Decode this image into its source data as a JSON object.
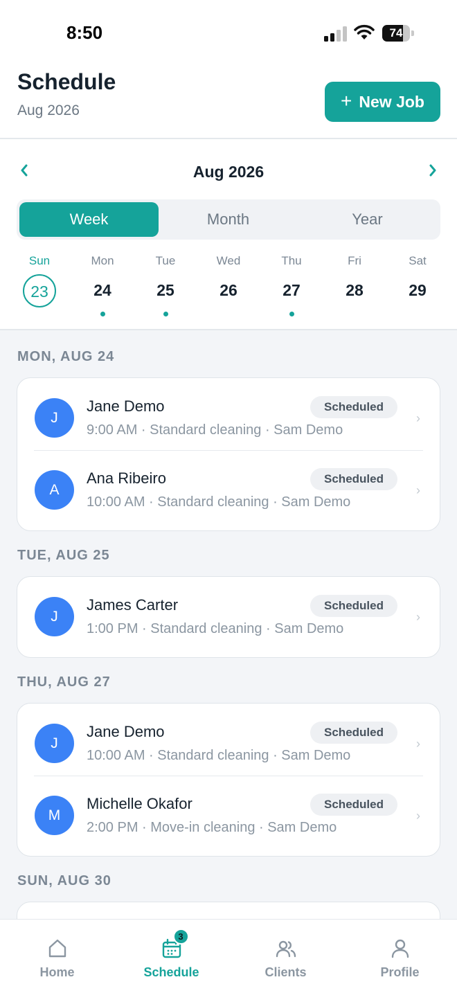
{
  "status_bar": {
    "time": "8:50",
    "battery": "74",
    "battery_level": 0.74
  },
  "header": {
    "title": "Schedule",
    "subtitle": "Aug 2026",
    "new_job_label": "New Job"
  },
  "calendar": {
    "month_label": "Aug 2026",
    "prev_icon": "chevron-left-icon",
    "next_icon": "chevron-right-icon",
    "views": [
      "Week",
      "Month",
      "Year"
    ],
    "active_view": "Week",
    "days": [
      {
        "name": "Sun",
        "number": "23",
        "selected": true,
        "has_jobs": false
      },
      {
        "name": "Mon",
        "number": "24",
        "selected": false,
        "has_jobs": true
      },
      {
        "name": "Tue",
        "number": "25",
        "selected": false,
        "has_jobs": true
      },
      {
        "name": "Wed",
        "number": "26",
        "selected": false,
        "has_jobs": false
      },
      {
        "name": "Thu",
        "number": "27",
        "selected": false,
        "has_jobs": true
      },
      {
        "name": "Fri",
        "number": "28",
        "selected": false,
        "has_jobs": false
      },
      {
        "name": "Sat",
        "number": "29",
        "selected": false,
        "has_jobs": false
      }
    ]
  },
  "sections": [
    {
      "heading": "MON, AUG 24",
      "jobs": [
        {
          "initial": "J",
          "name": "Jane Demo",
          "details": "9:00 AM · Standard cleaning · Sam Demo",
          "status": "Scheduled"
        },
        {
          "initial": "A",
          "name": "Ana Ribeiro",
          "details": "10:00 AM · Standard cleaning · Sam Demo",
          "status": "Scheduled"
        }
      ]
    },
    {
      "heading": "TUE, AUG 25",
      "jobs": [
        {
          "initial": "J",
          "name": "James Carter",
          "details": "1:00 PM · Standard cleaning · Sam Demo",
          "status": "Scheduled"
        }
      ]
    },
    {
      "heading": "THU, AUG 27",
      "jobs": [
        {
          "initial": "J",
          "name": "Jane Demo",
          "details": "10:00 AM · Standard cleaning · Sam Demo",
          "status": "Scheduled"
        },
        {
          "initial": "M",
          "name": "Michelle Okafor",
          "details": "2:00 PM · Move-in cleaning · Sam Demo",
          "status": "Scheduled"
        }
      ]
    },
    {
      "heading": "SUN, AUG 30",
      "jobs": []
    }
  ],
  "tab_bar": {
    "items": [
      {
        "label": "Home",
        "icon": "home-icon",
        "active": false
      },
      {
        "label": "Schedule",
        "icon": "calendar-icon",
        "active": true,
        "badge": "3"
      },
      {
        "label": "Clients",
        "icon": "users-icon",
        "active": false
      },
      {
        "label": "Profile",
        "icon": "user-icon",
        "active": false
      }
    ]
  },
  "colors": {
    "accent": "#15a39a",
    "avatar": "#3b82f6",
    "background": "#f3f5f8"
  }
}
